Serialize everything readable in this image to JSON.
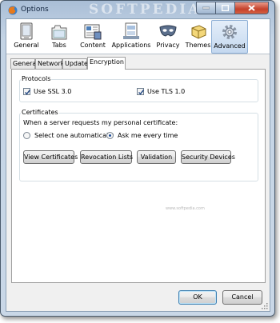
{
  "window": {
    "title": "Options",
    "watermark": "SOFTPEDIA"
  },
  "toolbar": {
    "items": [
      {
        "label": "General",
        "icon": "general-icon"
      },
      {
        "label": "Tabs",
        "icon": "tabs-icon"
      },
      {
        "label": "Content",
        "icon": "content-icon"
      },
      {
        "label": "Applications",
        "icon": "applications-icon"
      },
      {
        "label": "Privacy",
        "icon": "privacy-mask-icon"
      },
      {
        "label": "Themes",
        "icon": "themes-icon"
      },
      {
        "label": "Advanced",
        "icon": "advanced-gear-icon",
        "selected": true
      }
    ]
  },
  "subtabs": {
    "items": [
      "General",
      "Network",
      "Update",
      "Encryption"
    ],
    "active": "Encryption"
  },
  "protocols": {
    "title": "Protocols",
    "ssl_label": "Use SSL 3.0",
    "ssl_checked": true,
    "tls_label": "Use TLS 1.0",
    "tls_checked": true
  },
  "certificates": {
    "title": "Certificates",
    "prompt": "When a server requests my personal certificate:",
    "option_auto": "Select one automatically",
    "option_ask": "Ask me every time",
    "selected": "ask",
    "buttons": {
      "view": "View Certificates",
      "revocation": "Revocation Lists",
      "validation": "Validation",
      "security": "Security Devices"
    }
  },
  "watermark_small": "www.softpedia.com",
  "dialog": {
    "ok": "OK",
    "cancel": "Cancel"
  },
  "colors": {
    "selected_tab_bg": "#c4d8ef",
    "close_button": "#c4412b",
    "frame": "#c9d7e7"
  }
}
